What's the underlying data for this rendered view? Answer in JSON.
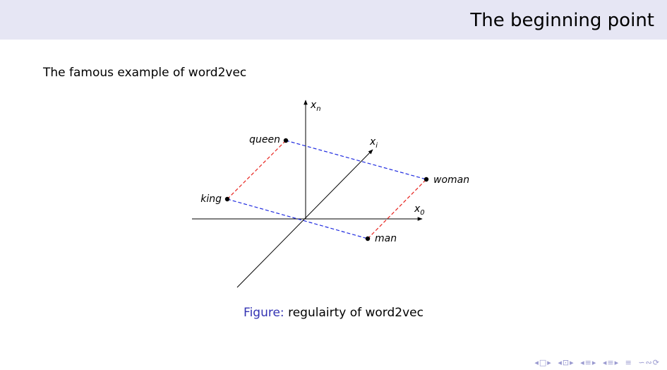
{
  "header": {
    "title": "The beginning point"
  },
  "intro": "The famous example of word2vec",
  "axes": {
    "x0": {
      "base": "x",
      "sub": "0"
    },
    "xn": {
      "base": "x",
      "sub": "n"
    },
    "xi": {
      "base": "x",
      "sub": "i"
    }
  },
  "points": {
    "queen": "queen",
    "king": "king",
    "woman": "woman",
    "man": "man"
  },
  "colors": {
    "gender_edge": "#e8231e",
    "royal_edge": "#1f2be0",
    "axis": "#000000",
    "header_bg": "#e6e6f4",
    "figure_label": "#3333b3"
  },
  "caption": {
    "label": "Figure:",
    "text": "regulairty of word2vec"
  },
  "navigation": {
    "icons": [
      "nav-first-icon",
      "nav-frame-icon",
      "nav-subsection-icon",
      "nav-section-icon",
      "nav-align-icon",
      "nav-search-icon"
    ]
  }
}
